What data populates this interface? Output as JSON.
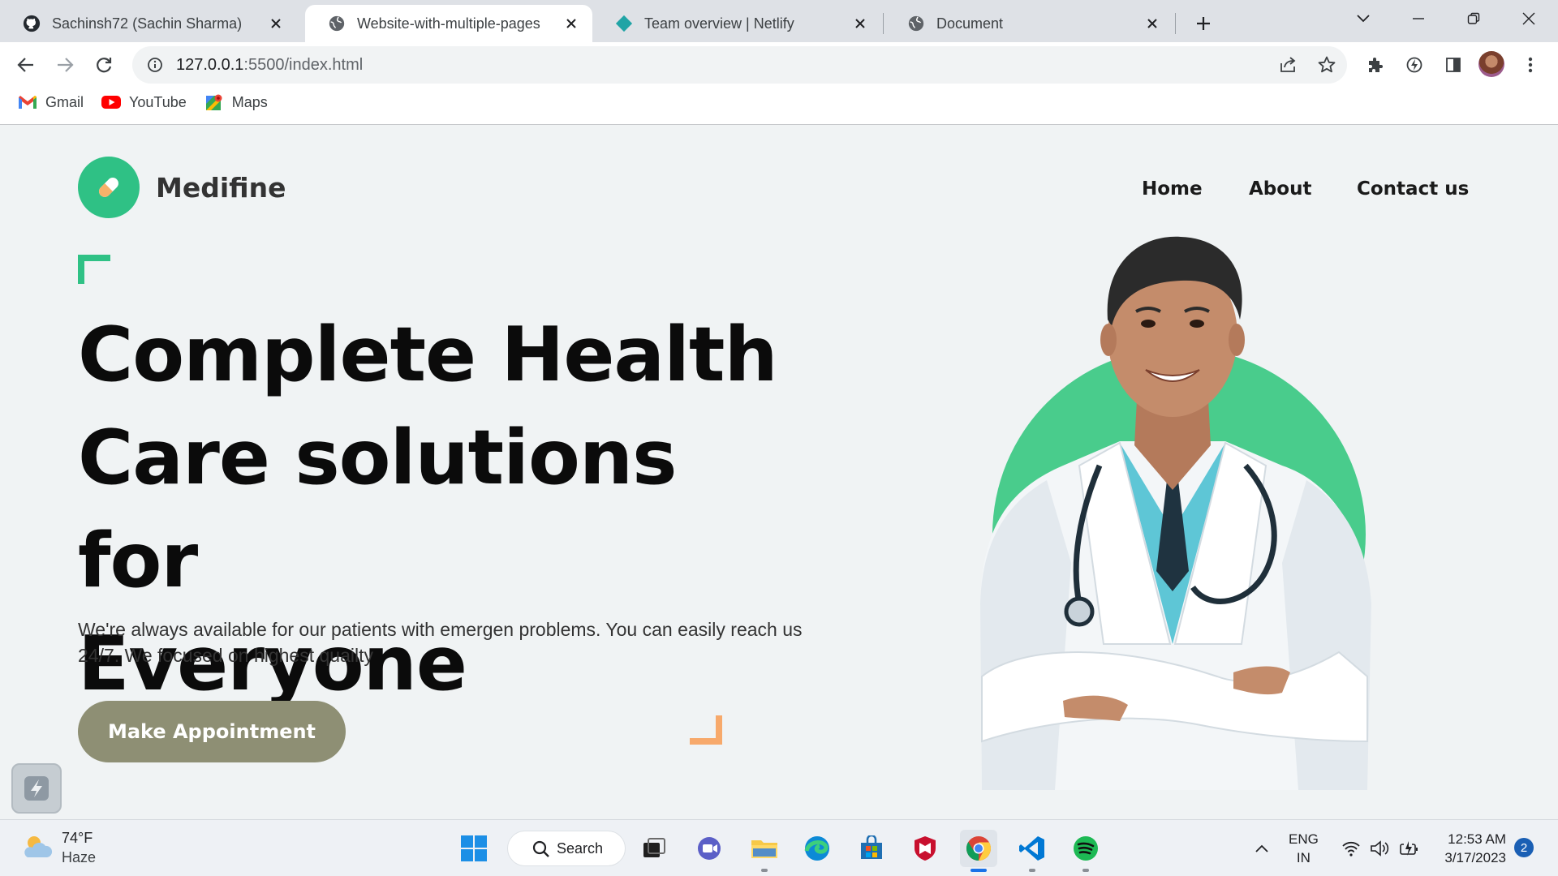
{
  "browser": {
    "tabs": [
      {
        "title": "Sachinsh72 (Sachin Sharma)",
        "icon": "github-icon",
        "active": false
      },
      {
        "title": "Website-with-multiple-pages",
        "icon": "globe-icon",
        "active": true
      },
      {
        "title": "Team overview | Netlify",
        "icon": "netlify-icon",
        "active": false
      },
      {
        "title": "Document",
        "icon": "globe-icon",
        "active": false
      }
    ],
    "url_host": "127.0.0.1",
    "url_path": ":5500/index.html",
    "bookmarks": [
      {
        "label": "Gmail",
        "icon": "gmail-icon"
      },
      {
        "label": "YouTube",
        "icon": "youtube-icon"
      },
      {
        "label": "Maps",
        "icon": "maps-icon"
      }
    ]
  },
  "site": {
    "brand": "Medifine",
    "nav": [
      "Home",
      "About",
      "Contact us"
    ],
    "headline_lines": [
      "Complete Health",
      "Care solutions for",
      "Everyone"
    ],
    "subtext": "We're always available for our patients with emergen problems. You can easily reach us 24/7. We focused on highest quailty",
    "cta": "Make Appointment",
    "colors": {
      "accent_green": "#2fc185",
      "circle_green": "#49cc8c",
      "cta_olive": "#8e8f74",
      "accent_orange": "#f7a96b"
    }
  },
  "taskbar": {
    "weather_temp": "74°F",
    "weather_desc": "Haze",
    "search_label": "Search",
    "lang_top": "ENG",
    "lang_bottom": "IN",
    "time": "12:53 AM",
    "date": "3/17/2023",
    "notification_count": "2"
  }
}
